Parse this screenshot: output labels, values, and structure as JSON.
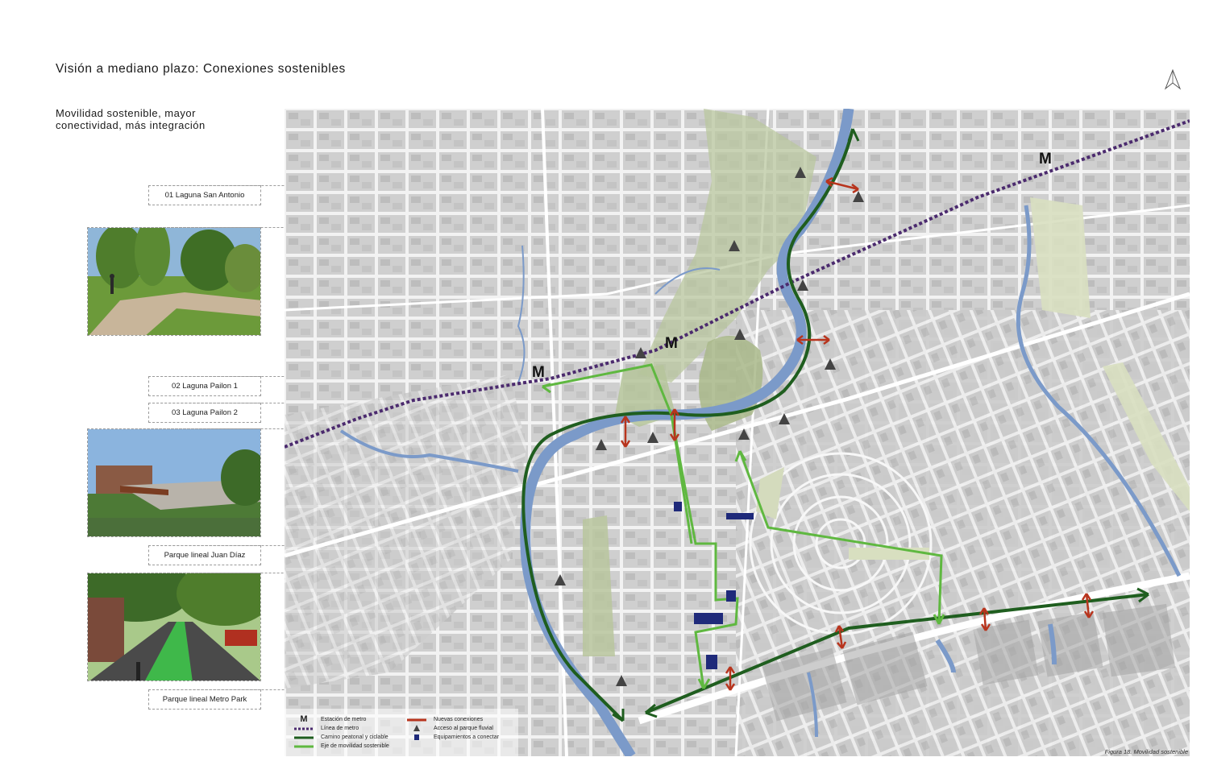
{
  "page": {
    "title": "Visión a mediano plazo: Conexiones sostenibles",
    "subtitle": "Movilidad sostenible, mayor conectividad, más integración",
    "figure_caption": "Figura 18.  Movilidad sostenible"
  },
  "locations": [
    {
      "label": "01 Laguna San Antonio"
    },
    {
      "label": "02 Laguna Pailon 1"
    },
    {
      "label": "03 Laguna Pailon 2"
    },
    {
      "label": "Parque lineal Juan Díaz"
    },
    {
      "label": "Parque lineal Metro Park"
    }
  ],
  "photos": [
    {
      "name": "photo-park-path-cyclist",
      "sky": "#8fb6d8",
      "ground": "#6c9a3a"
    },
    {
      "name": "photo-pedestrian-bridge",
      "sky": "#8bb4de",
      "ground": "#4d7a36"
    },
    {
      "name": "photo-green-bike-lane",
      "sky": "#a9c98a",
      "ground": "#3fb84a"
    }
  ],
  "map": {
    "metro_markers": [
      {
        "label": "M"
      },
      {
        "label": "M"
      },
      {
        "label": "M"
      }
    ],
    "colors": {
      "metro_line": "#4b2a6e",
      "pedestrian_path": "#1f5e1f",
      "mobility_axis": "#5fb840",
      "new_connections": "#b8341d",
      "river": "#7b9ac9",
      "equipment": "#1f2a7a",
      "park_access": "#444444"
    }
  },
  "legend": [
    {
      "symbol": "M",
      "label": "Estación de metro"
    },
    {
      "symbol": "metro-line",
      "label": "Línea de metro"
    },
    {
      "symbol": "dark-green-line",
      "label": "Camino peatonal y ciclable"
    },
    {
      "symbol": "light-green-line",
      "label": "Eje de movilidad sostenible"
    },
    {
      "symbol": "red-line",
      "label": "Nuevas conexiones"
    },
    {
      "symbol": "triangle",
      "label": "Acceso al parque fluvial"
    },
    {
      "symbol": "square",
      "label": "Equipamientos a conectar"
    }
  ]
}
